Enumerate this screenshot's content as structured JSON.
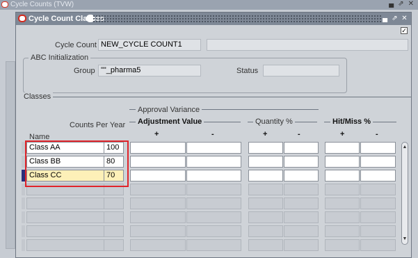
{
  "outer_window": {
    "title": "Cycle Counts (TVW)"
  },
  "window": {
    "title": "Cycle Count Classes"
  },
  "cycle_count": {
    "label": "Cycle Count",
    "value": "NEW_CYCLE COUNT1",
    "description": ""
  },
  "abc_init": {
    "legend": "ABC Initialization",
    "group_label": "Group",
    "group_value": "\"\"_pharma5",
    "status_label": "Status",
    "status_value": ""
  },
  "classes": {
    "legend": "Classes",
    "headers": {
      "name": "Name",
      "counts_per_year": "Counts Per Year",
      "approval_variance": "Approval Variance",
      "adjustment_value": "Adjustment Value",
      "quantity_pct": "Quantity %",
      "hit_miss_pct": "Hit/Miss %",
      "plus": "+",
      "minus": "-"
    },
    "rows": [
      {
        "name": "Class AA",
        "counts": "100"
      },
      {
        "name": "Class BB",
        "counts": "80"
      },
      {
        "name": "Class CC",
        "counts": "70"
      }
    ]
  },
  "colors": {
    "highlight": "#e0242a",
    "selected_row": "#fdf0b8",
    "titlebar": "#7e8896"
  },
  "icons": [
    "oracle-app-icon",
    "minimize-icon",
    "maximize-icon",
    "close-icon",
    "checkmark-icon",
    "scroll-up-icon",
    "scroll-down-icon"
  ]
}
